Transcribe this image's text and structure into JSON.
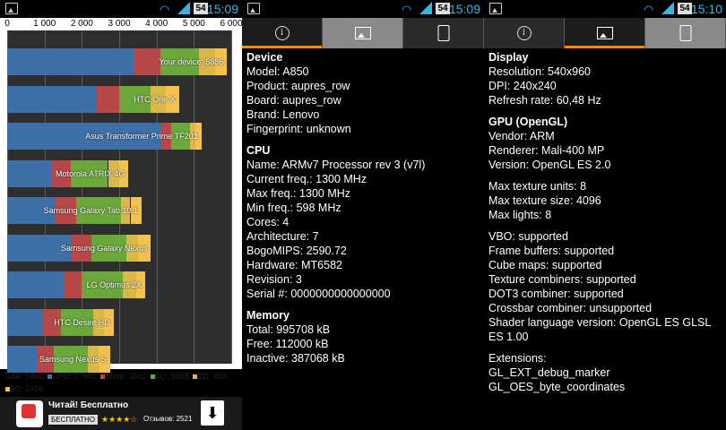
{
  "status": {
    "time": "15:09",
    "battery": "54"
  },
  "status3": {
    "time": "15:10",
    "battery": "54"
  },
  "chart_data": {
    "type": "bar",
    "stacked": true,
    "orientation": "horizontal",
    "xlim": [
      0,
      6000
    ],
    "xticks": [
      "0",
      "1 000",
      "2 000",
      "3 000",
      "4 000",
      "5 000",
      "6 000"
    ],
    "categories": [
      "Your device: 5886",
      "HTC One X",
      "Asus Transformer Prime TF201",
      "Motorola ATRIX 4G",
      "Samsung Galaxy Tab 10.1",
      "Samsung Galaxy Nexus",
      "LG Optimus 2X",
      "HTC Desire HD",
      "Samsung Nexus S"
    ],
    "series": [
      {
        "name": "CPU",
        "color": "#3f6fa8",
        "values": [
          3380,
          2400,
          4100,
          1200,
          1300,
          1700,
          1500,
          950,
          800
        ]
      },
      {
        "name": "Mem",
        "color": "#b84848",
        "values": [
          730,
          600,
          300,
          500,
          550,
          550,
          500,
          500,
          450
        ]
      },
      {
        "name": "I/O",
        "color": "#6aa83c",
        "values": [
          1020,
          850,
          500,
          1000,
          1200,
          950,
          1100,
          850,
          900
        ]
      },
      {
        "name": "2D",
        "color": "#d9b84a",
        "values": [
          430,
          400,
          150,
          300,
          250,
          300,
          350,
          300,
          300
        ]
      },
      {
        "name": "3D",
        "color": "#f2c14e",
        "values": [
          326,
          350,
          150,
          250,
          300,
          350,
          250,
          250,
          300
        ]
      }
    ],
    "legend": "Total: 5886 ■ CPU: 17865 ■ Mem: 3592 ■ I/O: 5058 ■ 2D: 459 ■ 3D: 2456"
  },
  "legend": {
    "total": "Total: 5886",
    "cpu": "CPU: 17865",
    "mem": "Mem: 3592",
    "io": "I/O: 5058",
    "d2": "2D: 459",
    "d3": "3D: 2456"
  },
  "ad": {
    "title": "Читай! Бесплатно",
    "badge": "БЕСПЛАТНО",
    "stars": "★★★★☆",
    "reviews": "Отзывов: 2521",
    "download_glyph": "⬇"
  },
  "device": {
    "heading": "Device",
    "lines": [
      "Model: A850",
      "Product: aupres_row",
      "Board: aupres_row",
      "Brand: Lenovo",
      "Fingerprint: unknown"
    ]
  },
  "cpu": {
    "heading": "CPU",
    "lines": [
      "Name: ARMv7 Processor rev 3 (v7l)",
      "Current freq.: 1300 MHz",
      "Max freq.: 1300 MHz",
      "Min freq.: 598 MHz",
      "Cores: 4",
      "Architecture: 7",
      "BogoMIPS: 2590.72",
      "Hardware: MT6582",
      "Revision: 3",
      "Serial #: 0000000000000000"
    ]
  },
  "memory": {
    "heading": "Memory",
    "lines": [
      "Total: 995708 kB",
      "Free: 112000 kB",
      "Inactive: 387068 kB"
    ]
  },
  "display": {
    "heading": "Display",
    "lines": [
      "Resolution: 540x960",
      "DPI: 240x240",
      "Refresh rate: 60,48 Hz"
    ]
  },
  "gpu": {
    "heading": "GPU (OpenGL)",
    "lines": [
      "Vendor: ARM",
      "Renderer: Mali-400 MP",
      "Version: OpenGL ES 2.0"
    ],
    "lines2": [
      "Max texture units: 8",
      "Max texture size: 4096",
      "Max lights: 8"
    ],
    "lines3": [
      "VBO: supported",
      "Frame buffers: supported",
      "Cube maps: supported",
      "Texture combiners: supported",
      "DOT3 combiner: supported",
      "Crossbar combiner: unsupported",
      "Shader language version: OpenGL ES GLSL ES 1.00"
    ],
    "lines4": [
      "Extensions:",
      "GL_EXT_debug_marker",
      "GL_OES_byte_coordinates"
    ]
  }
}
